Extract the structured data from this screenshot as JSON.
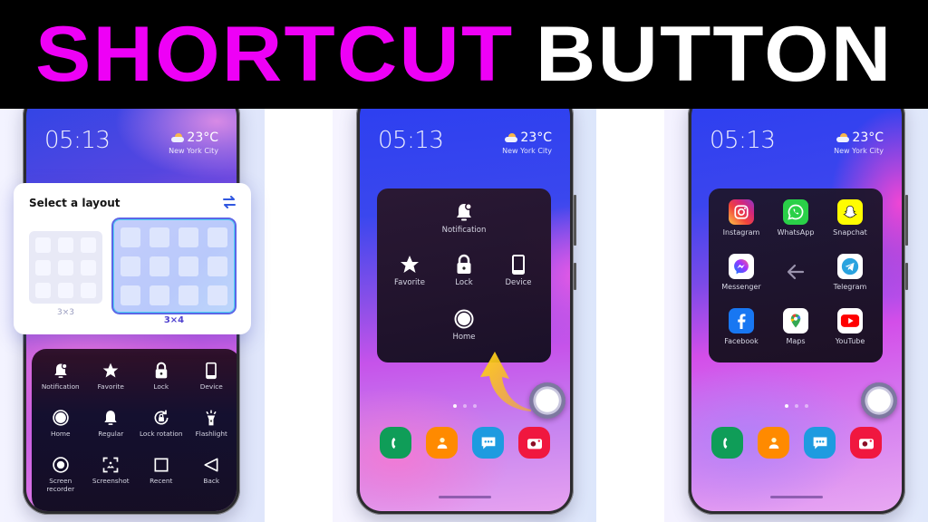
{
  "banner": {
    "word1": "SHORTCUT",
    "word2": "BUTTON",
    "color1": "#ee00f6",
    "color2": "#ffffff"
  },
  "lockscreen": {
    "time": "05:13",
    "temperature": "23°C",
    "city": "New York City",
    "weather_icon": "partly-cloudy-icon"
  },
  "phone1": {
    "layout_card": {
      "title": "Select a layout",
      "swap_icon": "swap-arrows-icon",
      "options": [
        {
          "label": "3×3",
          "selected": false
        },
        {
          "label": "3×4",
          "selected": true
        }
      ]
    },
    "shortcuts": [
      {
        "label": "Notification",
        "icon": "notification-bell-icon"
      },
      {
        "label": "Favorite",
        "icon": "star-icon"
      },
      {
        "label": "Lock",
        "icon": "lock-icon"
      },
      {
        "label": "Device",
        "icon": "device-icon"
      },
      {
        "label": "Home",
        "icon": "home-circle-icon"
      },
      {
        "label": "Regular",
        "icon": "bell-icon"
      },
      {
        "label": "Lock rotation",
        "icon": "lock-rotation-icon"
      },
      {
        "label": "Flashlight",
        "icon": "flashlight-icon"
      },
      {
        "label": "Screen recorder",
        "icon": "screen-recorder-icon"
      },
      {
        "label": "Screenshot",
        "icon": "screenshot-icon"
      },
      {
        "label": "Recent",
        "icon": "recent-square-icon"
      },
      {
        "label": "Back",
        "icon": "back-triangle-icon"
      }
    ]
  },
  "phone2": {
    "menu": [
      {
        "label": "Notification",
        "icon": "notification-bell-icon"
      },
      {
        "label": "Favorite",
        "icon": "star-icon"
      },
      {
        "label": "Lock",
        "icon": "lock-icon"
      },
      {
        "label": "Device",
        "icon": "device-icon"
      },
      {
        "label": "Home",
        "icon": "home-circle-icon"
      }
    ]
  },
  "phone3": {
    "apps": [
      {
        "label": "Instagram",
        "color": "#e1306c"
      },
      {
        "label": "WhatsApp",
        "color": "#25d366"
      },
      {
        "label": "Snapchat",
        "color": "#fffc00"
      },
      {
        "label": "Messenger",
        "color": "#ffffff"
      },
      {
        "label": "Telegram",
        "color": "#ffffff"
      },
      {
        "label": "Facebook",
        "color": "#1877f2"
      },
      {
        "label": "Maps",
        "color": "#ffffff"
      },
      {
        "label": "YouTube",
        "color": "#ffffff"
      }
    ],
    "back_icon": "back-arrow-icon"
  },
  "dock": [
    {
      "name": "phone",
      "color": "#0f9d58"
    },
    {
      "name": "contacts",
      "color": "#ff8a00"
    },
    {
      "name": "messages",
      "color": "#1e9be0"
    },
    {
      "name": "camera",
      "color": "#f0173f"
    }
  ],
  "page_dots": {
    "count": 3,
    "active": 1
  }
}
